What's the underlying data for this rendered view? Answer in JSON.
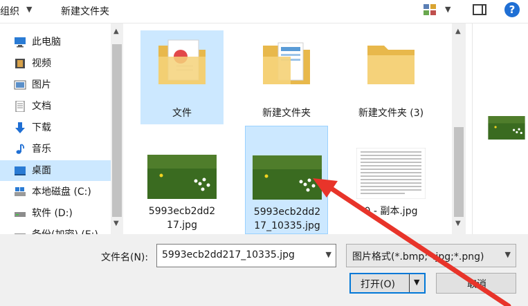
{
  "toolbar": {
    "organize_label": "组织",
    "new_folder_label": "新建文件夹"
  },
  "nav": {
    "items": [
      {
        "label": "此电脑",
        "icon": "computer-icon"
      },
      {
        "label": "视频",
        "icon": "video-icon"
      },
      {
        "label": "图片",
        "icon": "pictures-icon"
      },
      {
        "label": "文档",
        "icon": "documents-icon"
      },
      {
        "label": "下载",
        "icon": "download-icon"
      },
      {
        "label": "音乐",
        "icon": "music-icon"
      },
      {
        "label": "桌面",
        "icon": "desktop-icon",
        "selected": true
      },
      {
        "label": "本地磁盘 (C:)",
        "icon": "drive-c-icon"
      },
      {
        "label": "软件 (D:)",
        "icon": "drive-d-icon"
      },
      {
        "label": "备份(加密) (E:)",
        "icon": "drive-e-icon"
      }
    ]
  },
  "files": [
    {
      "name": "文件",
      "kind": "folder-docs",
      "selected": true
    },
    {
      "name": "新建文件夹",
      "kind": "folder-blue-docs"
    },
    {
      "name": "新建文件夹 (3)",
      "kind": "folder-empty"
    },
    {
      "name": "5993ecb2dd217.jpg",
      "kind": "image-grass"
    },
    {
      "name": "5993ecb2dd217_10335.jpg",
      "kind": "image-grass",
      "selected": true
    },
    {
      "name": "0 - 副本.jpg",
      "kind": "image-document"
    }
  ],
  "bottom": {
    "filename_label": "文件名(N):",
    "filename_value": "5993ecb2dd217_10335.jpg",
    "filetype_value": "图片格式(*.bmp;*.jpg;*.png)",
    "open_label": "打开(O)",
    "cancel_label": "取消"
  },
  "colors": {
    "selection": "#cce8ff",
    "accent": "#0078d7",
    "arrow": "#e8342a"
  }
}
